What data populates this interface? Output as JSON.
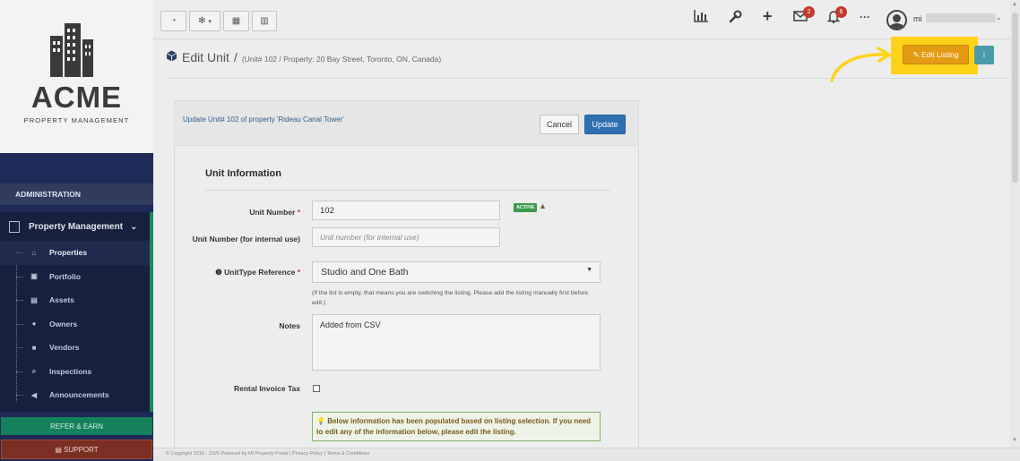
{
  "brand": {
    "name": "ACME",
    "tagline": "PROPERTY MANAGEMENT"
  },
  "sidebar": {
    "section_label": "ADMINISTRATION",
    "group_label": "Property Management",
    "items": [
      {
        "label": "Properties",
        "icon": "home-icon",
        "glyph": "⌂"
      },
      {
        "label": "Portfolio",
        "icon": "portfolio-icon",
        "glyph": "▣"
      },
      {
        "label": "Assets",
        "icon": "assets-icon",
        "glyph": "▤"
      },
      {
        "label": "Owners",
        "icon": "owner-icon",
        "glyph": "●"
      },
      {
        "label": "Vendors",
        "icon": "briefcase-icon",
        "glyph": "■"
      },
      {
        "label": "Inspections",
        "icon": "search-icon",
        "glyph": "⌕"
      },
      {
        "label": "Announcements",
        "icon": "bullhorn-icon",
        "glyph": "◀"
      }
    ],
    "refer_label": "REFER & EARN",
    "support_label": "SUPPORT"
  },
  "topbar": {
    "mail_badge": "2",
    "notif_badge": "6",
    "more_label": "···",
    "user_name": "mi"
  },
  "page": {
    "title": "Edit Unit",
    "separator": "/",
    "breadcrumb": "(Unit# 102 / Property: 20 Bay Street, Toronto, ON, Canada)",
    "edit_listing_label": "Edit Listing",
    "info_label": "i"
  },
  "form": {
    "update_text": "Update Unit# 102 of property 'Rideau Canal Tower'",
    "cancel_label": "Cancel",
    "update_label": "Update",
    "section_title": "Unit Information",
    "unit_number_label": "Unit Number",
    "unit_number_value": "102",
    "status_badge": "ACTIVE",
    "internal_label": "Unit Number (for internal use)",
    "internal_placeholder": "Unit number (for internal use)",
    "unittype_label": "UnitType Reference",
    "unittype_value": "Studio and One Bath",
    "unittype_help": "(If the list is empty, that means you are switching the listing. Please add the listing manually first before edit.)",
    "notes_label": "Notes",
    "notes_value": "Added from CSV",
    "tax_label": "Rental Invoice Tax",
    "tax_checked": false,
    "notice": "Below information has been populated based on listing selection. If you need to edit any of the information below, please edit the listing."
  },
  "footer": {
    "text": "© Copyright 2016 - 2026 Powered by MI Property Portal | Privacy Policy | Terms & Conditions"
  },
  "colors": {
    "sidebar_bg": "#1e2a57",
    "highlight": "#ffd21a",
    "edit_listing_bg": "#e39b14",
    "primary": "#2c6fb3",
    "refer": "#15805c",
    "support": "#7b2f22"
  }
}
